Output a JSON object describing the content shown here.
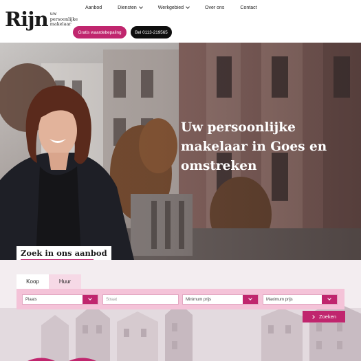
{
  "logo": {
    "mark": "Rijn",
    "sub_line1": "uw",
    "sub_line2": "persoonlijke",
    "sub_line3": "makelaar"
  },
  "nav": [
    {
      "label": "Aanbod",
      "has_dropdown": false
    },
    {
      "label": "Diensten",
      "has_dropdown": true
    },
    {
      "label": "Werkgebied",
      "has_dropdown": true
    },
    {
      "label": "Over ons",
      "has_dropdown": false
    },
    {
      "label": "Contact",
      "has_dropdown": false
    }
  ],
  "buttons": {
    "valuation": "Gratis waardebepaling",
    "call": "Bel 0113-219565"
  },
  "hero": {
    "title": "Uw persoonlijke makelaar in Goes en omstreken"
  },
  "search": {
    "heading": "Zoek in ons aanbod",
    "tabs": [
      {
        "label": "Koop",
        "active": true
      },
      {
        "label": "Huur",
        "active": false
      }
    ],
    "fields": {
      "plaats": "Plaats",
      "straat_placeholder": "Straat",
      "min_price": "Minimum prijs",
      "max_price": "Maximum prijs"
    },
    "submit": "Zoeken"
  },
  "colors": {
    "brand": "#c0266e",
    "panel": "#f4c3d8",
    "dark": "#0e0e0e",
    "whatsapp": "#25d366"
  }
}
